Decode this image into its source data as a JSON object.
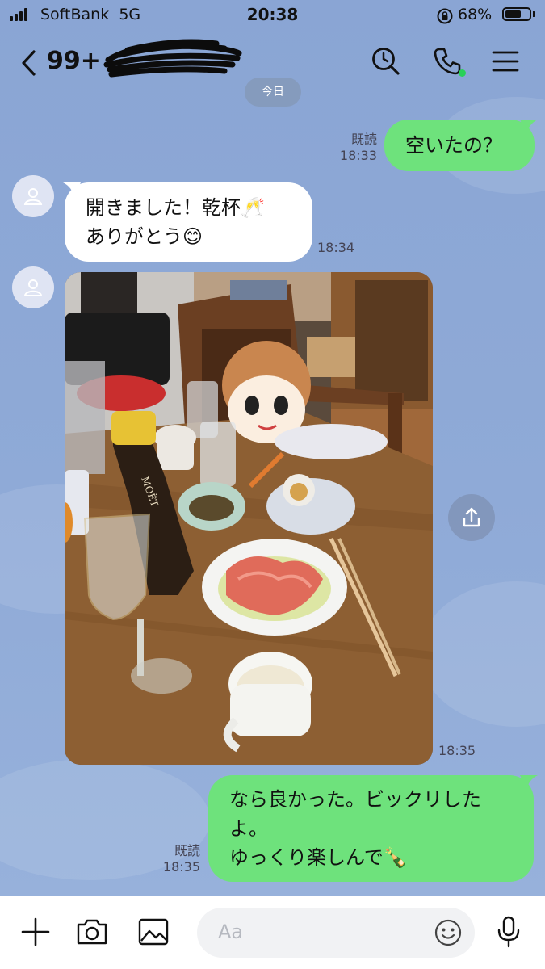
{
  "status_bar": {
    "carrier": "SoftBank",
    "network": "5G",
    "time": "20:38",
    "battery_pct": "68%",
    "battery_level": 0.68
  },
  "header": {
    "back_icon": "chevron-left-icon",
    "unread_count": "99+",
    "icons": [
      "search-clock-icon",
      "phone-icon",
      "menu-icon"
    ]
  },
  "date_separator": "今日",
  "messages": [
    {
      "side": "me",
      "text": "空いたの？",
      "read": "既読",
      "time": "18:33"
    },
    {
      "side": "them",
      "lines": [
        "開きました！乾杯🥂",
        "ありがとう😊"
      ],
      "time": "18:34"
    },
    {
      "side": "them",
      "type": "photo",
      "time": "18:35"
    },
    {
      "side": "me",
      "lines": [
        "なら良かった。ビックリした",
        "よ。",
        "ゆっくり楽しんで🍾"
      ],
      "read": "既読",
      "time": "18:35"
    }
  ],
  "photo_labels": {
    "bottle_label": "MOËT"
  },
  "input": {
    "placeholder": "Aa"
  },
  "colors": {
    "chat_bg": "#8faad7",
    "my_bubble": "#6ee27c",
    "their_bubble": "#ffffff",
    "online_dot": "#2ad158"
  }
}
